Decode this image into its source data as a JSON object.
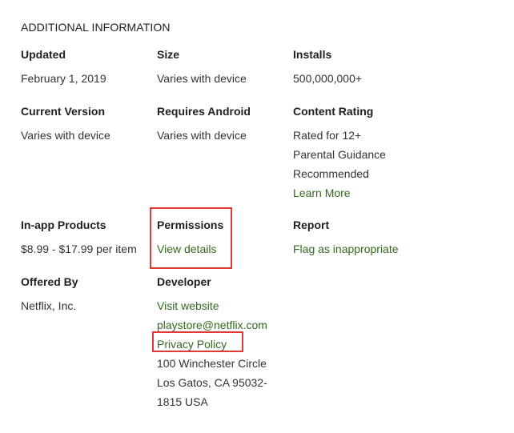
{
  "section": {
    "title": "ADDITIONAL INFORMATION"
  },
  "updated": {
    "label": "Updated",
    "value": "February 1, 2019"
  },
  "size": {
    "label": "Size",
    "value": "Varies with device"
  },
  "installs": {
    "label": "Installs",
    "value": "500,000,000+"
  },
  "current_version": {
    "label": "Current Version",
    "value": "Varies with device"
  },
  "requires_android": {
    "label": "Requires Android",
    "value": "Varies with device"
  },
  "content_rating": {
    "label": "Content Rating",
    "lines": [
      "Rated for 12+",
      "Parental Guidance",
      "Recommended"
    ],
    "link": "Learn More"
  },
  "in_app_products": {
    "label": "In-app Products",
    "value": "$8.99 - $17.99 per item"
  },
  "permissions": {
    "label": "Permissions",
    "link": "View details"
  },
  "report": {
    "label": "Report",
    "link": "Flag as inappropriate"
  },
  "offered_by": {
    "label": "Offered By",
    "value": "Netflix, Inc."
  },
  "developer": {
    "label": "Developer",
    "website": "Visit website",
    "email": "playstore@netflix.com",
    "privacy": "Privacy Policy",
    "address": [
      "100 Winchester Circle",
      "Los Gatos, CA 95032-",
      "1815 USA"
    ]
  },
  "colors": {
    "link": "#33691e",
    "highlight": "#e53935"
  }
}
